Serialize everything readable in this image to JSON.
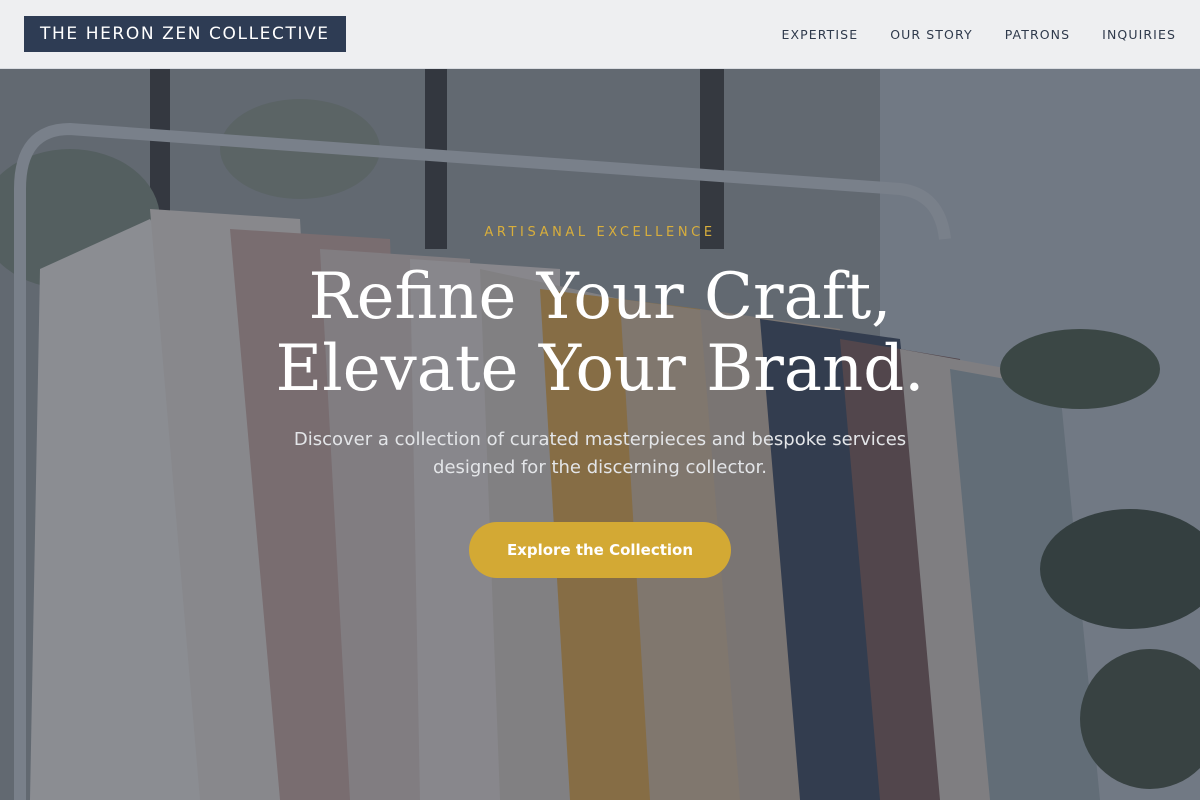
{
  "header": {
    "brand": "THE HERON ZEN COLLECTIVE",
    "nav": [
      {
        "label": "EXPERTISE"
      },
      {
        "label": "OUR STORY"
      },
      {
        "label": "PATRONS"
      },
      {
        "label": "INQUIRIES"
      }
    ]
  },
  "hero": {
    "eyebrow": "ARTISANAL EXCELLENCE",
    "headline_line1": "Refine Your Craft,",
    "headline_line2": "Elevate Your Brand.",
    "subtext_line1": "Discover a collection of curated masterpieces and bespoke services",
    "subtext_line2": "designed for the discerning collector.",
    "cta_label": "Explore the Collection",
    "background": "clothing-rack-photo"
  },
  "colors": {
    "brand_bg": "#2e3c54",
    "accent_gold": "#d3a934",
    "eyebrow_gold": "#d8ae3c",
    "header_bg": "#f3f4f6",
    "nav_text": "#2f3a4c"
  }
}
